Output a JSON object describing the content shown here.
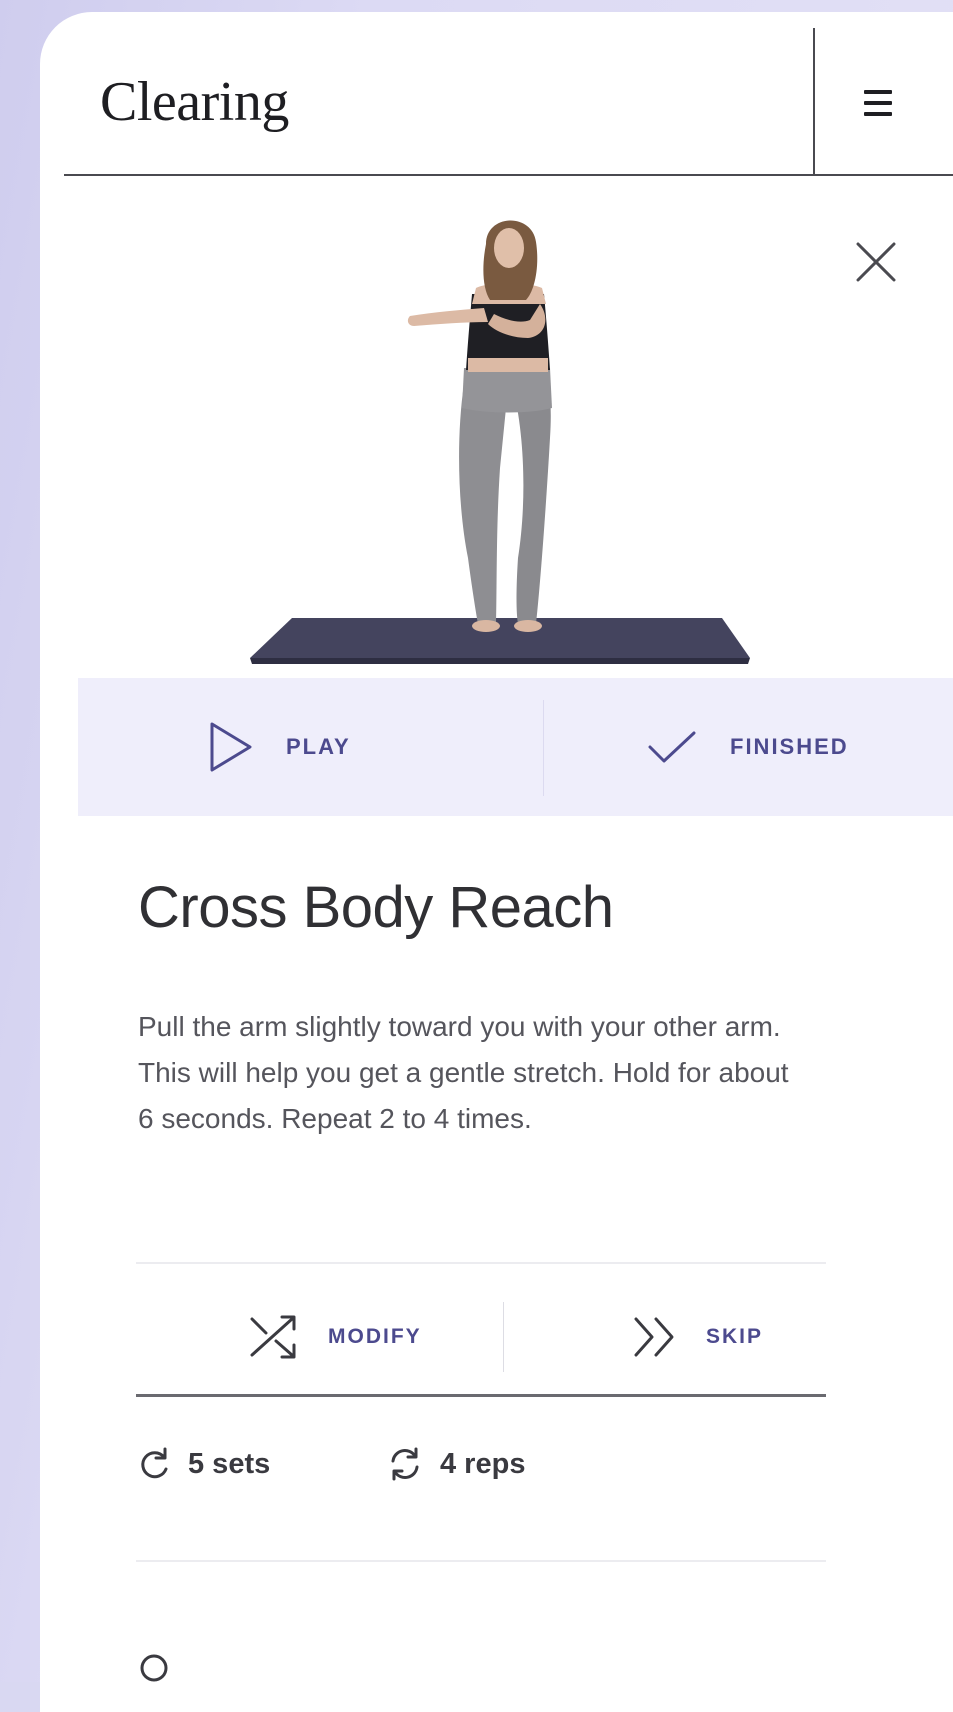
{
  "app": {
    "brand": "Clearing",
    "menu_icon": "hamburger-menu-icon",
    "close_icon": "close-icon"
  },
  "exercise": {
    "title": "Cross Body Reach",
    "description": "Pull the arm slightly toward you with your other arm. This will help you get a gentle stretch. Hold for about 6 seconds. Repeat 2 to 4 times."
  },
  "actions": {
    "play_label": "PLAY",
    "play_icon": "play-icon",
    "finished_label": "FINISHED",
    "finished_icon": "checkmark-icon",
    "modify_label": "MODIFY",
    "modify_icon": "shuffle-icon",
    "skip_label": "SKIP",
    "skip_icon": "double-chevron-right-icon"
  },
  "stats": {
    "sets": "5 sets",
    "sets_icon": "rotate-icon",
    "reps": "4 reps",
    "reps_icon": "repeat-icon"
  },
  "colors": {
    "accent": "#4c4a8e",
    "action_bar_bg": "#efeefb",
    "backdrop": "#d9d8f2"
  }
}
